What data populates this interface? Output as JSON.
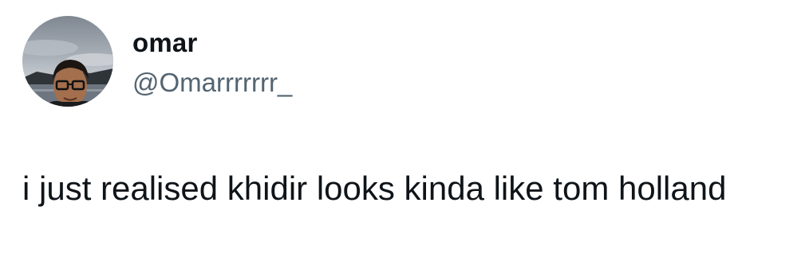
{
  "tweet": {
    "author": {
      "display_name": "omar",
      "handle": "@Omarrrrrrr_",
      "avatar_icon": "avatar-photo"
    },
    "text": "i just realised khidir looks kinda like tom holland"
  },
  "colors": {
    "background": "#ffffff",
    "primary_text": "#0f1419",
    "secondary_text": "#536471"
  }
}
